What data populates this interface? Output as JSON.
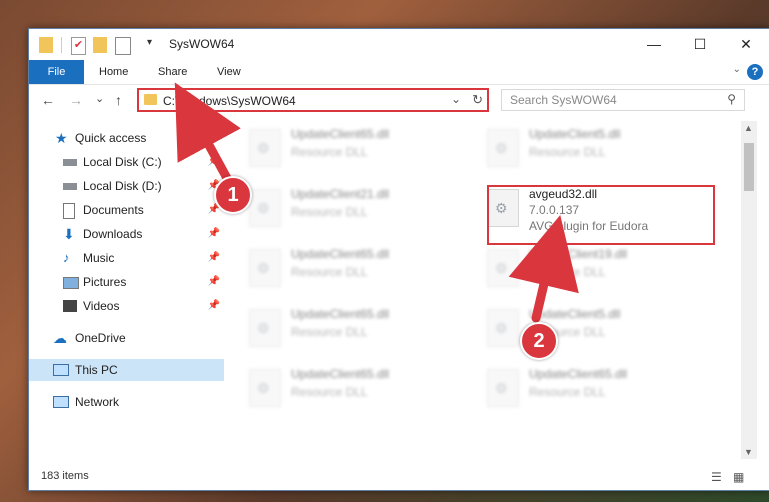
{
  "window": {
    "title": "SysWOW64",
    "minimize": "—",
    "maximize": "☐",
    "close": "✕"
  },
  "ribbon": {
    "tabs": [
      "File",
      "Home",
      "Share",
      "View"
    ],
    "help": "?"
  },
  "nav": {
    "back": "←",
    "forward": "→",
    "recent": "⌄",
    "up": "↑",
    "address": "C:\\Windows\\SysWOW64",
    "search_placeholder": "Search SysWOW64"
  },
  "sidebar": {
    "items": [
      {
        "label": "Quick access",
        "icon": "star-icon"
      },
      {
        "label": "Local Disk (C:)",
        "icon": "drive-icon"
      },
      {
        "label": "Local Disk (D:)",
        "icon": "drive-icon"
      },
      {
        "label": "Documents",
        "icon": "documents-icon"
      },
      {
        "label": "Downloads",
        "icon": "download-icon"
      },
      {
        "label": "Music",
        "icon": "music-icon"
      },
      {
        "label": "Pictures",
        "icon": "pictures-icon"
      },
      {
        "label": "Videos",
        "icon": "videos-icon"
      },
      {
        "label": "OneDrive",
        "icon": "cloud-icon"
      },
      {
        "label": "This PC",
        "icon": "computer-icon"
      },
      {
        "label": "Network",
        "icon": "network-icon"
      }
    ]
  },
  "files": [
    {
      "name": "UpdateClient65.dll",
      "desc": "Resource DLL"
    },
    {
      "name": "UpdateClient5.dll",
      "desc": "Resource DLL"
    },
    {
      "name": "UpdateClient21.dll",
      "desc": "Resource DLL"
    },
    {
      "name": "avgeud32.dll",
      "version": "7.0.0.137",
      "desc": "AVG plugin for Eudora"
    },
    {
      "name": "UpdateClient65.dll",
      "desc": "Resource DLL"
    },
    {
      "name": "UpdateClient19.dll",
      "desc": "Resource DLL"
    },
    {
      "name": "UpdateClient65.dll",
      "desc": "Resource DLL"
    },
    {
      "name": "UpdateClient5.dll",
      "desc": "Resource DLL"
    },
    {
      "name": "UpdateClient65.dll",
      "desc": "Resource DLL"
    },
    {
      "name": "UpdateClient65.dll",
      "desc": "Resource DLL"
    }
  ],
  "status": {
    "count": "183 items"
  },
  "callouts": [
    "1",
    "2"
  ],
  "colors": {
    "accent": "#1a6fbf",
    "highlight": "#d9363e",
    "selected": "#cce4f7"
  }
}
